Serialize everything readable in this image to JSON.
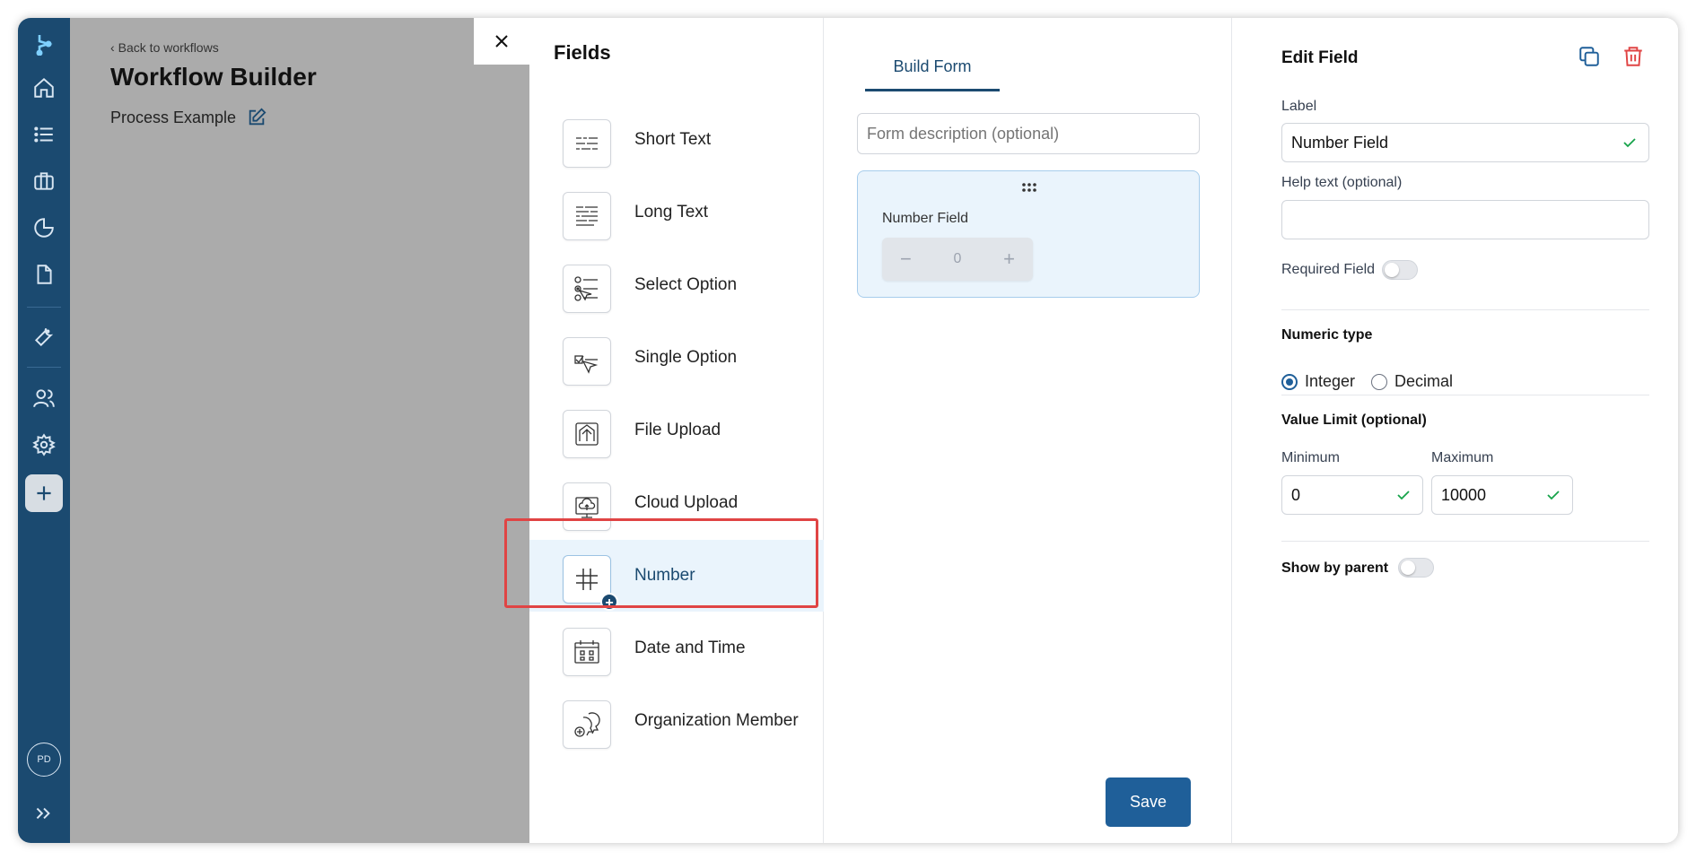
{
  "background": {
    "back_link": "Back to workflows",
    "title": "Workflow Builder",
    "process_name": "Process Example"
  },
  "sidebar": {
    "avatar": "PD",
    "items": [
      "home-icon",
      "list-icon",
      "briefcase-icon",
      "pie-chart-icon",
      "document-icon",
      "wrench-icon",
      "users-icon",
      "gear-icon",
      "plus-icon",
      "expand-icon"
    ]
  },
  "fields": {
    "title": "Fields",
    "items": [
      {
        "label": "Short Text",
        "icon": "short-text-icon"
      },
      {
        "label": "Long Text",
        "icon": "long-text-icon"
      },
      {
        "label": "Select Option",
        "icon": "select-option-icon"
      },
      {
        "label": "Single Option",
        "icon": "single-option-icon"
      },
      {
        "label": "File Upload",
        "icon": "file-upload-icon"
      },
      {
        "label": "Cloud Upload",
        "icon": "cloud-upload-icon"
      },
      {
        "label": "Number",
        "icon": "hash-icon"
      },
      {
        "label": "Date and Time",
        "icon": "calendar-icon"
      },
      {
        "label": "Organization Member",
        "icon": "organization-member-icon"
      }
    ],
    "selected": "Number"
  },
  "build": {
    "tab": "Build Form",
    "description_placeholder": "Form description (optional)",
    "card_label": "Number Field",
    "stepper_value": "0",
    "stepper_minus": "−",
    "stepper_plus": "+",
    "save": "Save"
  },
  "edit": {
    "title": "Edit Field",
    "label_title": "Label",
    "label_value": "Number Field",
    "help_title": "Help text (optional)",
    "help_value": "",
    "required_label": "Required Field",
    "required_on": false,
    "numeric_type_title": "Numeric type",
    "numeric_options": [
      "Integer",
      "Decimal"
    ],
    "numeric_selected": "Integer",
    "value_limit_title": "Value Limit (optional)",
    "minimum_label": "Minimum",
    "minimum_value": "0",
    "maximum_label": "Maximum",
    "maximum_value": "10000",
    "show_by_parent_label": "Show by parent",
    "show_by_parent_on": false
  },
  "colors": {
    "sidebar": "#1b4a70",
    "accent": "#1f5f99",
    "highlight": "#e04444",
    "success": "#16a34a"
  }
}
